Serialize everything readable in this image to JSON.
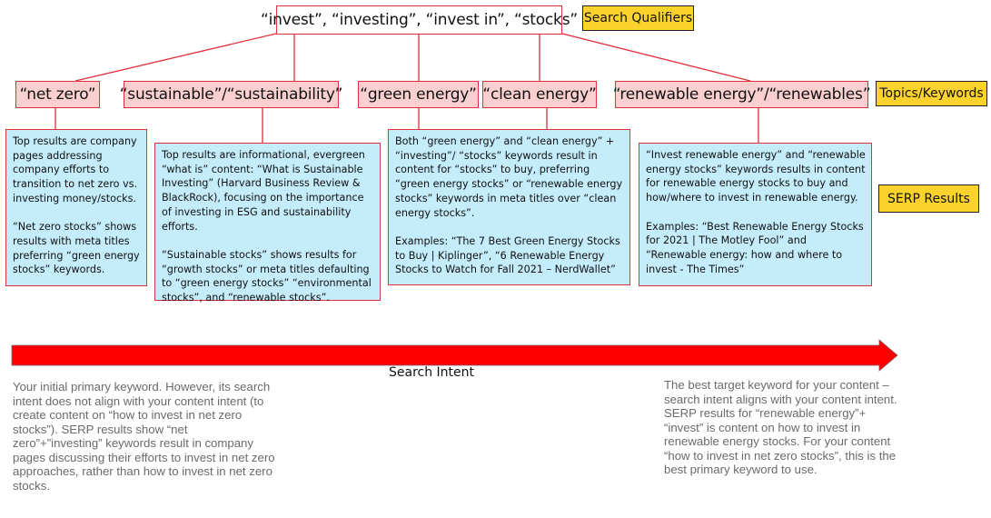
{
  "diagram": {
    "root": {
      "label": "“invest”, “investing”, “invest in”, “stocks”"
    },
    "legend": {
      "search_qualifiers": "Search Qualifiers",
      "topics_keywords": "Topics/Keywords",
      "serp_results": "SERP Results"
    },
    "colors": {
      "connector": "#e0303c",
      "keyword_fill": "#f9cfd0",
      "serp_fill": "#c4ecfa",
      "legend_fill": "#fcd22d",
      "arrow_fill": "#ff0000"
    },
    "keywords": [
      {
        "label": "“net zero”"
      },
      {
        "label": "“sustainable”/“sustainability”"
      },
      {
        "label": "“green energy”"
      },
      {
        "label": "“clean energy”"
      },
      {
        "label": "“renewable energy”/“renewables”"
      }
    ],
    "serp": [
      {
        "p1": "Top results are company pages addressing company efforts to transition to net zero vs. investing money/stocks.",
        "p2": "“Net zero stocks” shows results with meta titles preferring “green energy stocks” keywords."
      },
      {
        "p1": "Top results are informational, evergreen “what is” content: “What is Sustainable Investing” (Harvard Business Review & BlackRock), focusing on the importance of investing in ESG and sustainability efforts.",
        "p2": "“Sustainable stocks” shows results for “growth stocks” or meta titles defaulting to “green energy stocks” “environmental stocks”, and “renewable stocks”."
      },
      {
        "p1": "Both “green energy” and “clean energy” + “investing”/ “stocks” keywords result in content for “stocks” to buy, preferring “green energy stocks” or “renewable energy stocks” keywords in meta titles over “clean energy stocks”.",
        "p2": "Examples:  “The 7 Best Green Energy Stocks to Buy | Kiplinger”, “6 Renewable Energy Stocks to Watch for Fall 2021 – NerdWallet”"
      },
      {
        "p1": "“Invest renewable energy” and “renewable energy stocks” keywords results in content for renewable energy stocks to buy and how/where to invest in renewable energy.",
        "p2": "Examples: “Best Renewable Energy Stocks for 2021 | The Motley Fool” and “Renewable energy: how and where to invest - The Times”"
      }
    ],
    "intent_arrow": {
      "label": "Search Intent",
      "icon": "right-arrow-icon"
    },
    "notes": {
      "left": "Your initial primary keyword. However, its search intent does not align with your content intent (to create content on “how to invest in net zero stocks”). SERP results show “net zero”+”investing” keywords result in company pages discussing their efforts to invest in net zero approaches, rather than how to invest in net zero stocks.",
      "right": "The best target keyword for your content – search intent aligns with your content intent. SERP results for “renewable energy”+ “invest” is content on how to invest in renewable energy stocks. For your content “how to invest in net zero stocks”, this is the best primary keyword to use."
    }
  }
}
